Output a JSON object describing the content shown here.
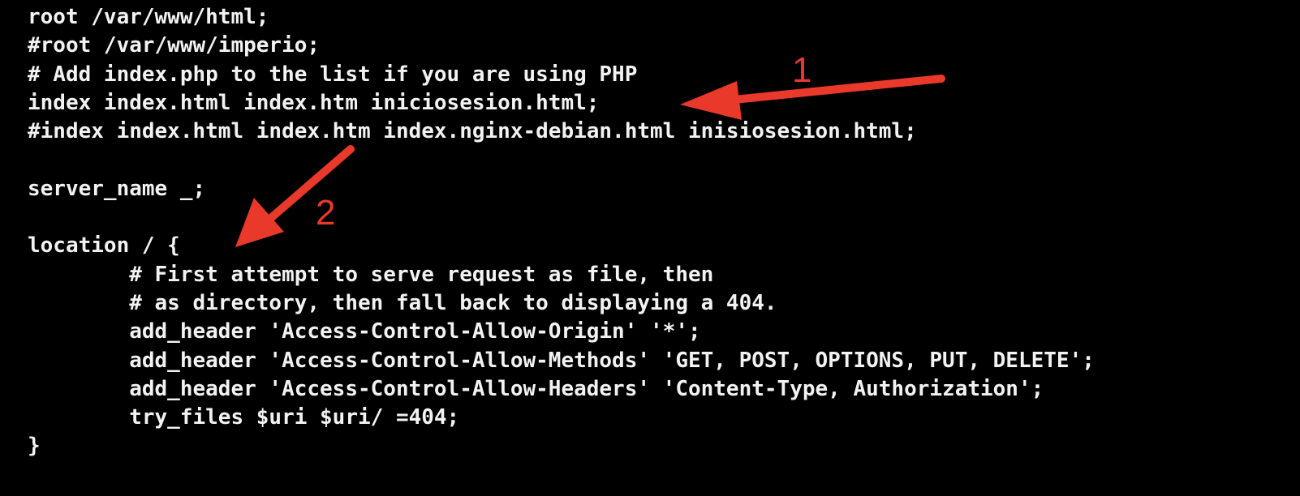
{
  "editor": {
    "lines": [
      "root /var/www/html;",
      "#root /var/www/imperio;",
      "# Add index.php to the list if you are using PHP",
      "index index.html index.htm iniciosesion.html;",
      "#index index.html index.htm index.nginx-debian.html inisiosesion.html;",
      "",
      "server_name _;",
      "",
      "location / {",
      "        # First attempt to serve request as file, then",
      "        # as directory, then fall back to displaying a 404.",
      "        add_header 'Access-Control-Allow-Origin' '*';",
      "        add_header 'Access-Control-Allow-Methods' 'GET, POST, OPTIONS, PUT, DELETE';",
      "        add_header 'Access-Control-Allow-Headers' 'Content-Type, Authorization';",
      "        try_files $uri $uri/ =404;",
      "}"
    ]
  },
  "annotations": {
    "color": "#e8392a",
    "arrow1_label": "1",
    "arrow2_label": "2"
  },
  "colors": {
    "background": "#000000",
    "text": "#f2f2f2"
  }
}
